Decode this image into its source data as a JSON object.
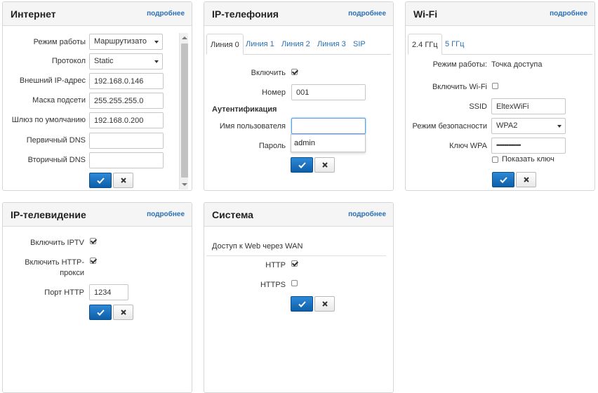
{
  "common": {
    "more_label": "подробнее"
  },
  "internet": {
    "title": "Интернет",
    "mode_label": "Режим работы",
    "mode_value": "Маршрутизато",
    "protocol_label": "Протокол",
    "protocol_value": "Static",
    "ip_label": "Внешний IP-адрес",
    "ip_value": "192.168.0.146",
    "mask_label": "Маска подсети",
    "mask_value": "255.255.255.0",
    "gateway_label": "Шлюз по умолчанию",
    "gateway_value": "192.168.0.200",
    "dns1_label": "Первичный DNS",
    "dns1_value": "",
    "dns2_label": "Вторичный DNS",
    "dns2_value": ""
  },
  "voip": {
    "title": "IP-телефония",
    "tabs": [
      "Линия 0",
      "Линия 1",
      "Линия 2",
      "Линия 3",
      "SIP"
    ],
    "enable_label": "Включить",
    "enable_checked": true,
    "number_label": "Номер",
    "number_value": "001",
    "auth_title": "Аутентификация",
    "username_label": "Имя пользователя",
    "username_value": "",
    "password_label": "Пароль",
    "autocomplete_option": "admin"
  },
  "wifi": {
    "title": "Wi-Fi",
    "tabs": [
      "2.4 ГГц",
      "5 ГГц"
    ],
    "mode_label": "Режим работы:",
    "mode_value": "Точка доступа",
    "enable_label": "Включить Wi-Fi",
    "enable_checked": false,
    "ssid_label": "SSID",
    "ssid_value": "EltexWiFi",
    "security_label": "Режим безопасности",
    "security_value": "WPA2",
    "key_label": "Ключ WPA",
    "key_value": "••••••••••••••••",
    "show_key_label": "Показать ключ",
    "show_key_checked": false
  },
  "iptv": {
    "title": "IP-телевидение",
    "enable_label": "Включить IPTV",
    "enable_checked": true,
    "http_proxy_label_1": "Включить HTTP-",
    "http_proxy_label_2": "прокси",
    "http_proxy_checked": true,
    "port_label": "Порт HTTP",
    "port_value": "1234"
  },
  "system": {
    "title": "Система",
    "wan_access_label": "Доступ к Web через WAN",
    "http_label": "HTTP",
    "http_checked": true,
    "https_label": "HTTPS",
    "https_checked": false
  },
  "colors": {
    "accent": "#2a6fb4",
    "ok_button": "#1a72c4",
    "border": "#d6d6d6"
  },
  "icons": {
    "ok": "check-icon",
    "cancel": "close-icon",
    "select": "chevron-down-icon"
  }
}
